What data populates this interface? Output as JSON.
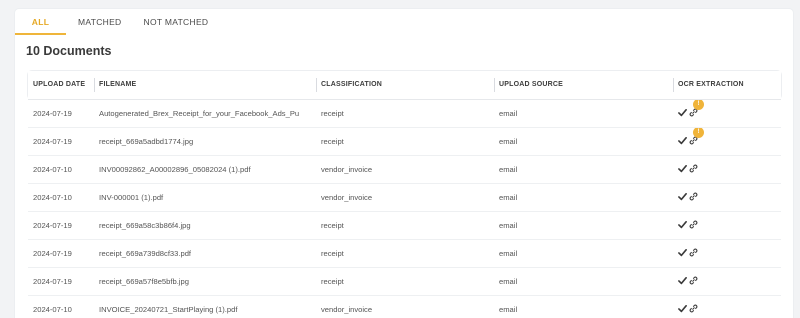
{
  "tabs": [
    {
      "label": "ALL",
      "active": true
    },
    {
      "label": "MATCHED",
      "active": false
    },
    {
      "label": "NOT MATCHED",
      "active": false
    }
  ],
  "page_title": "10 Documents",
  "colors": {
    "accent": "#efb53a",
    "badge": "#f0b43a"
  },
  "table": {
    "columns": [
      "UPLOAD DATE",
      "FILENAME",
      "CLASSIFICATION",
      "UPLOAD SOURCE",
      "OCR EXTRACTION"
    ],
    "rows": [
      {
        "date": "2024-07-19",
        "filename": "Autogenerated_Brex_Receipt_for_your_Facebook_Ads_Pu",
        "classification": "receipt",
        "source": "email",
        "ocr_icons": [
          "check-icon",
          "link-icon"
        ],
        "badge": "!"
      },
      {
        "date": "2024-07-19",
        "filename": "receipt_669a5adbd1774.jpg",
        "classification": "receipt",
        "source": "email",
        "ocr_icons": [
          "check-icon",
          "link-icon"
        ],
        "badge": "!"
      },
      {
        "date": "2024-07-10",
        "filename": "INV00092862_A00002896_05082024 (1).pdf",
        "classification": "vendor_invoice",
        "source": "email",
        "ocr_icons": [
          "check-icon",
          "link-icon"
        ],
        "badge": null
      },
      {
        "date": "2024-07-10",
        "filename": "INV-000001 (1).pdf",
        "classification": "vendor_invoice",
        "source": "email",
        "ocr_icons": [
          "check-icon",
          "link-icon"
        ],
        "badge": null
      },
      {
        "date": "2024-07-19",
        "filename": "receipt_669a58c3b86f4.jpg",
        "classification": "receipt",
        "source": "email",
        "ocr_icons": [
          "check-icon",
          "link-icon"
        ],
        "badge": null
      },
      {
        "date": "2024-07-19",
        "filename": "receipt_669a739d8cf33.pdf",
        "classification": "receipt",
        "source": "email",
        "ocr_icons": [
          "check-icon",
          "link-icon"
        ],
        "badge": null
      },
      {
        "date": "2024-07-19",
        "filename": "receipt_669a57f8e5bfb.jpg",
        "classification": "receipt",
        "source": "email",
        "ocr_icons": [
          "check-icon",
          "link-icon"
        ],
        "badge": null
      },
      {
        "date": "2024-07-10",
        "filename": "INVOICE_20240721_StartPlaying (1).pdf",
        "classification": "vendor_invoice",
        "source": "email",
        "ocr_icons": [
          "check-icon",
          "link-icon"
        ],
        "badge": null
      }
    ]
  }
}
